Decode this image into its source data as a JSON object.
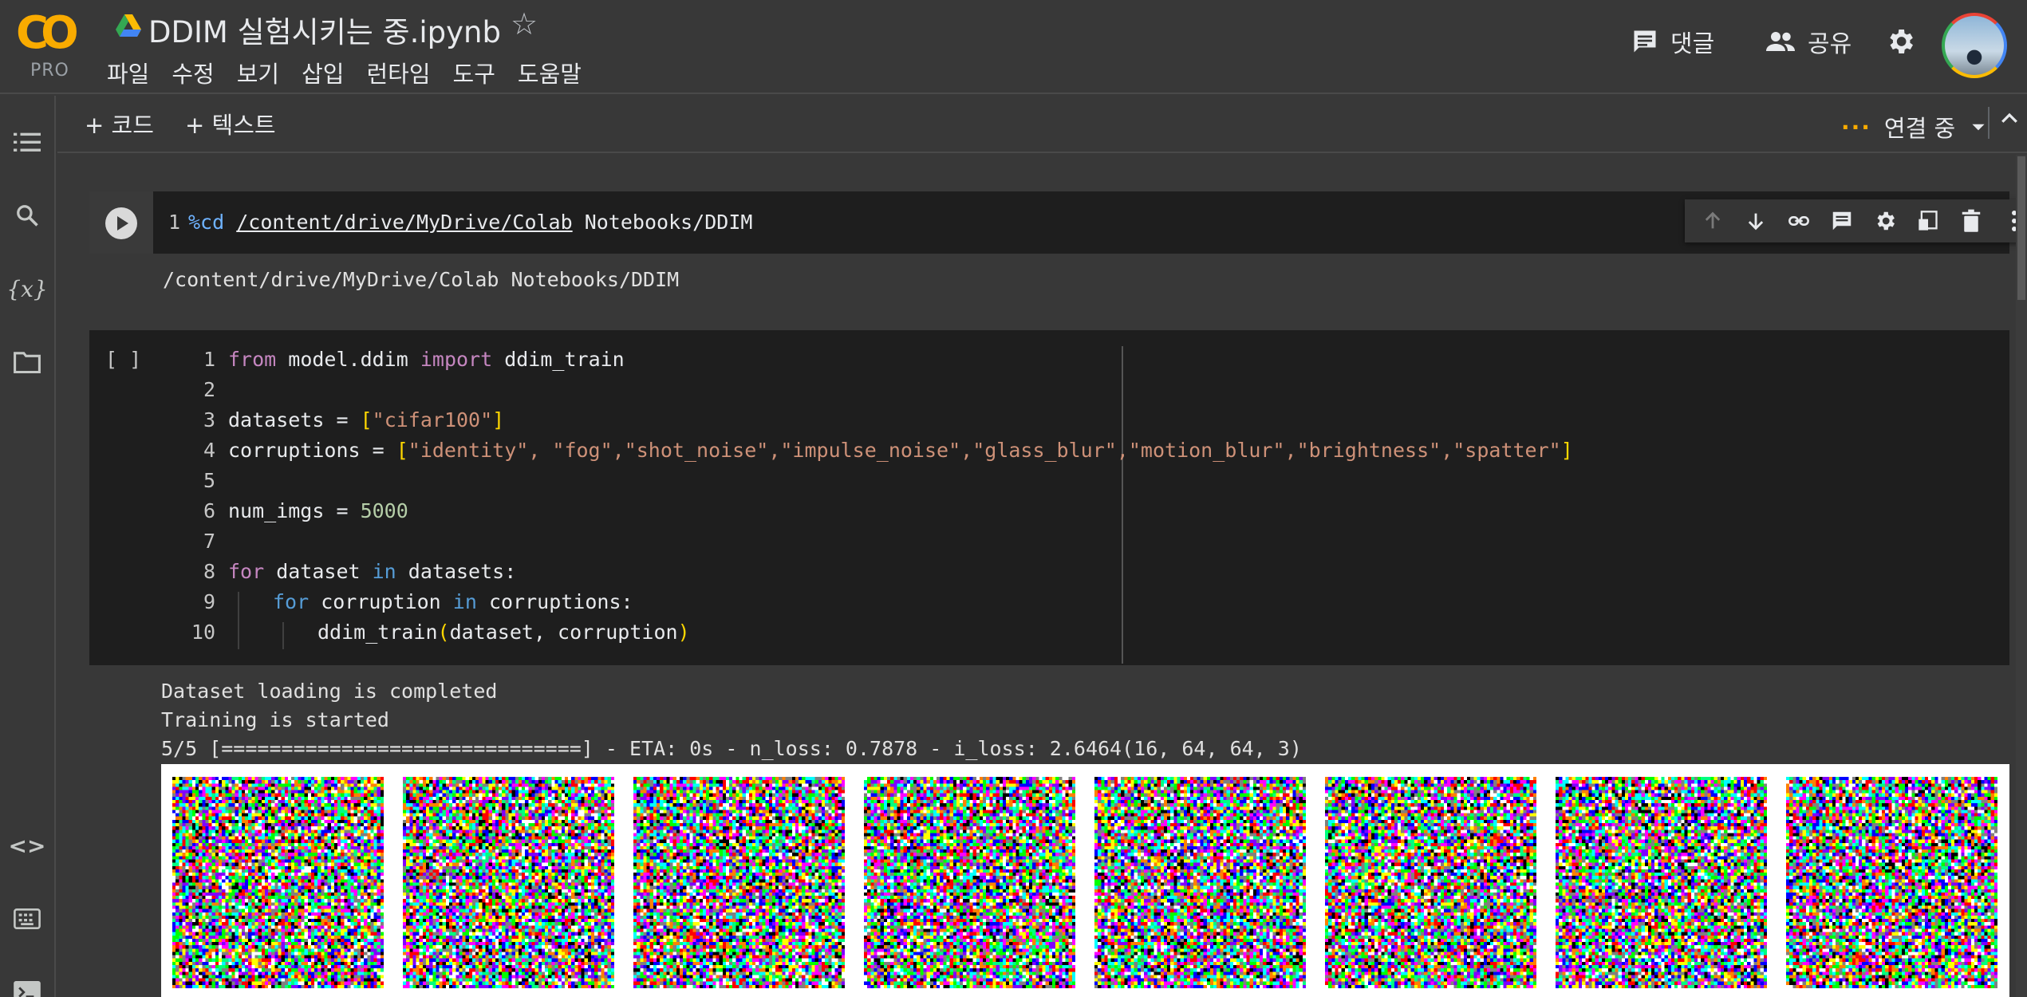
{
  "header": {
    "logo_text": "CO",
    "logo_badge": "PRO",
    "title": "DDIM 실험시키는 중.ipynb",
    "menu": [
      "파일",
      "수정",
      "보기",
      "삽입",
      "런타임",
      "도구",
      "도움말"
    ],
    "comment_label": "댓글",
    "share_label": "공유"
  },
  "toolbar": {
    "add_code": "+ 코드",
    "add_text": "+ 텍스트",
    "connect_status": "연결 중"
  },
  "cell1": {
    "line_number": "1",
    "magic": "%cd",
    "path": "/content/drive/MyDrive/Colab",
    "path_rest": " Notebooks/DDIM",
    "output": "/content/drive/MyDrive/Colab Notebooks/DDIM"
  },
  "cell2": {
    "exec_marker": "[ ]",
    "lines": [
      {
        "n": "1"
      },
      {
        "n": "2"
      },
      {
        "n": "3"
      },
      {
        "n": "4"
      },
      {
        "n": "5"
      },
      {
        "n": "6"
      },
      {
        "n": "7"
      },
      {
        "n": "8"
      },
      {
        "n": "9"
      },
      {
        "n": "10"
      }
    ],
    "l1": {
      "from": "from",
      "module": " model.ddim ",
      "import": "import",
      "name": " ddim_train"
    },
    "l3": {
      "var": "datasets = ",
      "open": "[",
      "s1": "\"cifar100\"",
      "close": "]"
    },
    "l4": {
      "var": "corruptions = ",
      "open": "[",
      "items": "\"identity\", \"fog\",\"shot_noise\",\"impulse_noise\",\"glass_blur\",\"motion_blur\",\"brightness\",\"spatter\"",
      "close": "]"
    },
    "l6": {
      "var": "num_imgs = ",
      "value": "5000"
    },
    "l8": {
      "for": "for",
      "a": " dataset ",
      "in": "in",
      "b": " datasets:"
    },
    "l9": {
      "for": "for",
      "a": " corruption ",
      "in": "in",
      "b": " corruptions:"
    },
    "l10": {
      "call": "ddim_train",
      "open": "(",
      "args": "dataset, corruption",
      "close": ")"
    }
  },
  "output2": {
    "line1": "Dataset loading is completed",
    "line2": "Training is started",
    "line3": "5/5 [==============================] - ETA: 0s - n_loss: 0.7878 - i_loss: 2.6464(16, 64, 64, 3)",
    "image_count": 8
  }
}
